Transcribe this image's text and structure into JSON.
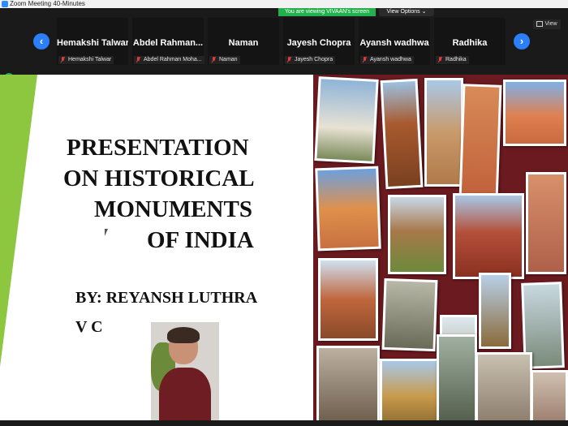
{
  "window": {
    "title": "Zoom Meeting 40-Minutes"
  },
  "share_banner": {
    "text": "You are viewing VIVAAN's screen"
  },
  "view_options": {
    "label": "View Options ⌄"
  },
  "view_button": {
    "label": "View"
  },
  "participants": [
    {
      "name": "Hemakshi Talwar",
      "label": "Hemakshi Talwar"
    },
    {
      "name": "Abdel  Rahman...",
      "label": "Abdel Rahman Moha..."
    },
    {
      "name": "Naman",
      "label": "Naman"
    },
    {
      "name": "Jayesh Chopra",
      "label": "Jayesh Chopra"
    },
    {
      "name": "Ayansh wadhwa",
      "label": "Ayansh wadhwa"
    },
    {
      "name": "Radhika",
      "label": "Radhika"
    }
  ],
  "nav": {
    "prev": "‹",
    "next": "›"
  },
  "slide": {
    "title_lines": [
      "PRESENTATION",
      "ON HISTORICAL",
      "MONUMENTS",
      "OF INDIA"
    ],
    "author_line1": "BY: REYANSH LUTHRA",
    "author_line2": "V C"
  },
  "colors": {
    "accent_green": "#8dc63f",
    "zoom_blue": "#2d7ff9",
    "share_green": "#23b14d",
    "collage_bg": "#6b1a1f"
  }
}
